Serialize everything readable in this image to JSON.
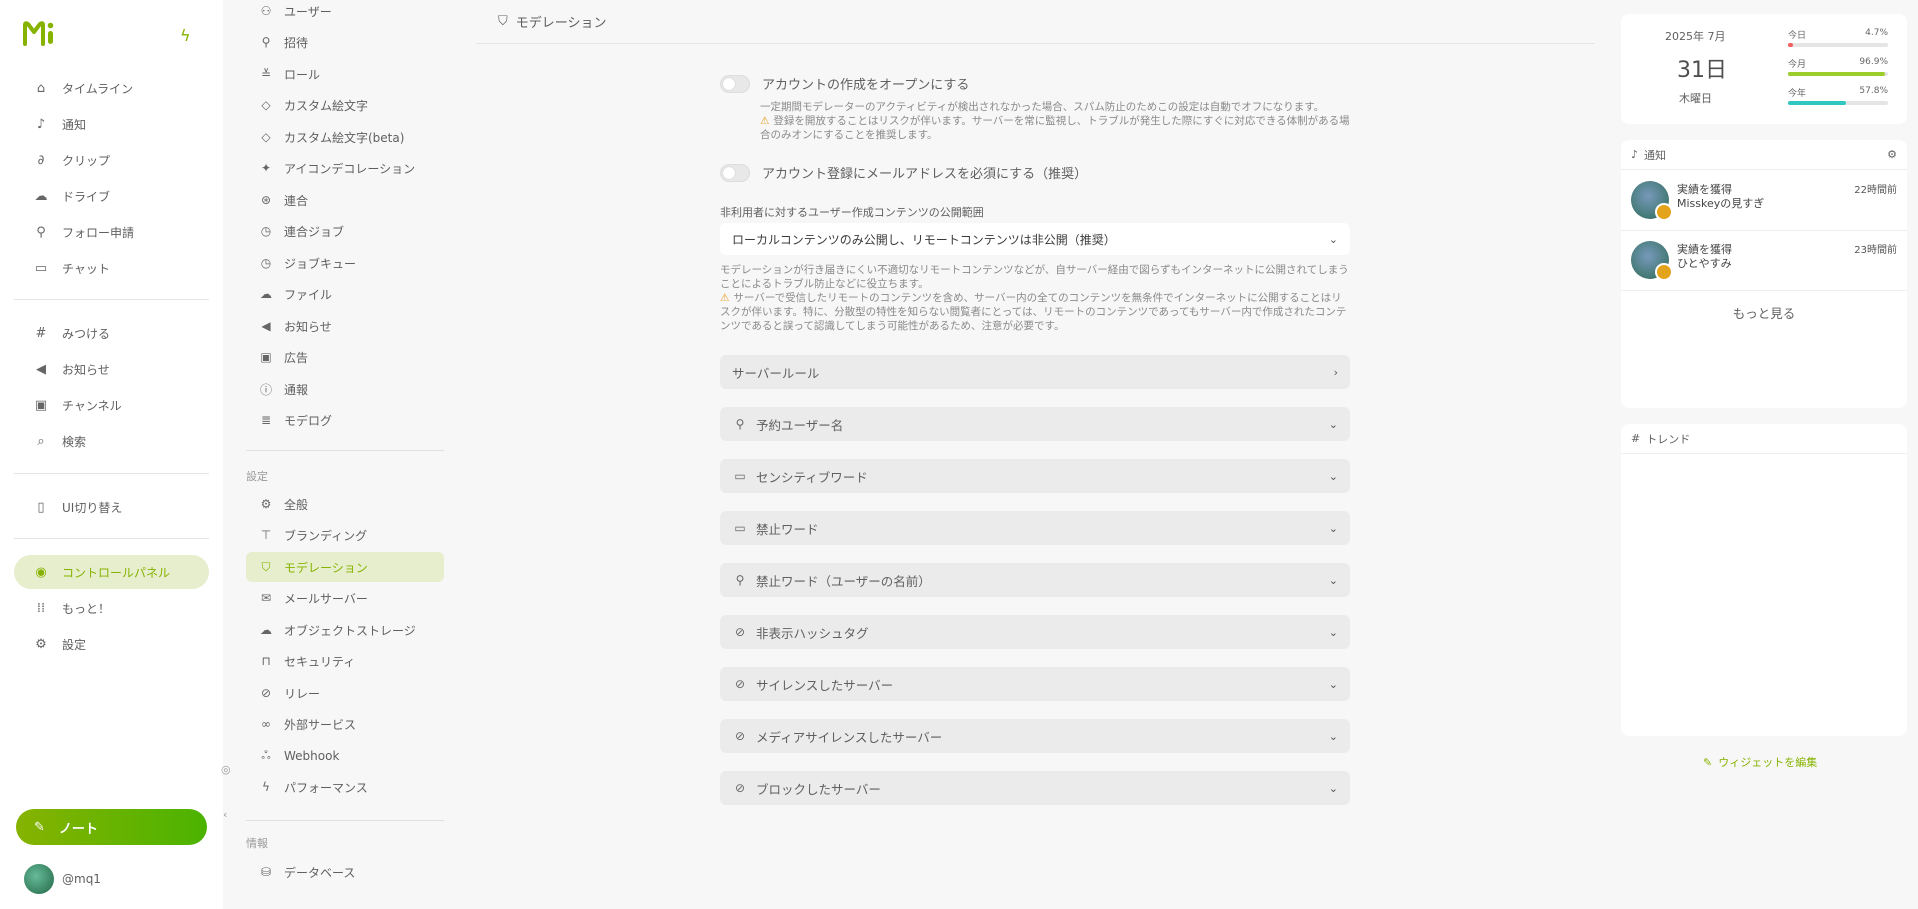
{
  "nav": {
    "items": [
      {
        "label": "タイムライン",
        "icon": "home-icon"
      },
      {
        "label": "通知",
        "icon": "bell-icon"
      },
      {
        "label": "クリップ",
        "icon": "paperclip-icon"
      },
      {
        "label": "ドライブ",
        "icon": "cloud-icon"
      },
      {
        "label": "フォロー申請",
        "icon": "user-plus-icon"
      },
      {
        "label": "チャット",
        "icon": "chat-icon"
      },
      {
        "label": "みつける",
        "icon": "hash-icon"
      },
      {
        "label": "お知らせ",
        "icon": "speaker-icon"
      },
      {
        "label": "チャンネル",
        "icon": "tv-icon"
      },
      {
        "label": "検索",
        "icon": "search-icon"
      },
      {
        "label": "UI切り替え",
        "icon": "devices-icon"
      },
      {
        "label": "コントロールパネル",
        "icon": "gauge-icon"
      },
      {
        "label": "もっと！",
        "icon": "grid-dots-icon"
      },
      {
        "label": "設定",
        "icon": "gear-icon"
      }
    ],
    "note_button": "ノート",
    "account": "@mq1"
  },
  "sidebar": {
    "admin_items": [
      "ユーザー",
      "招待",
      "ロール",
      "カスタム絵文字",
      "カスタム絵文字(beta)",
      "アイコンデコレーション",
      "連合",
      "連合ジョブ",
      "ジョブキュー",
      "ファイル",
      "お知らせ",
      "広告",
      "通報",
      "モデログ"
    ],
    "settings_label": "設定",
    "settings_items": [
      "全般",
      "ブランディング",
      "モデレーション",
      "メールサーバー",
      "オブジェクトストレージ",
      "セキュリティ",
      "リレー",
      "外部サービス",
      "Webhook",
      "パフォーマンス"
    ],
    "info_label": "情報",
    "info_items": [
      "データベース"
    ]
  },
  "main": {
    "title": "モデレーション",
    "toggle_open": "アカウントの作成をオープンにする",
    "toggle_open_caption": "一定期間モデレーターのアクティビティが検出されなかった場合、スパム防止のためこの設定は自動でオフになります。",
    "toggle_open_warn": "登録を開放することはリスクが伴います。サーバーを常に監視し、トラブルが発生した際にすぐに対応できる体制がある場合のみオンにすることを推奨します。",
    "toggle_email": "アカウント登録にメールアドレスを必須にする（推奨）",
    "select_label": "非利用者に対するユーザー作成コンテンツの公開範囲",
    "select_value": "ローカルコンテンツのみ公開し、リモートコンテンツは非公開（推奨）",
    "select_caption": "モデレーションが行き届きにくい不適切なリモートコンテンツなどが、自サーバー経由で図らずもインターネットに公開されてしまうことによるトラブル防止などに役立ちます。",
    "select_warn": "サーバーで受信したリモートのコンテンツを含め、サーバー内の全てのコンテンツを無条件でインターネットに公開することはリスクが伴います。特に、分散型の特性を知らない閲覧者にとっては、リモートのコンテンツであってもサーバー内で作成されたコンテンツであると誤って認識してしまう可能性があるため、注意が必要です。",
    "server_rules": "サーバールール",
    "folders": [
      {
        "label": "予約ユーザー名",
        "icon": "user-lock-icon"
      },
      {
        "label": "センシティブワード",
        "icon": "message-alert-icon"
      },
      {
        "label": "禁止ワード",
        "icon": "message-x-icon"
      },
      {
        "label": "禁止ワード（ユーザーの名前）",
        "icon": "user-x-icon"
      },
      {
        "label": "非表示ハッシュタグ",
        "icon": "eye-off-icon"
      },
      {
        "label": "サイレンスしたサーバー",
        "icon": "eye-off-icon"
      },
      {
        "label": "メディアサイレンスしたサーバー",
        "icon": "eye-off-icon"
      },
      {
        "label": "ブロックしたサーバー",
        "icon": "ban-icon"
      }
    ]
  },
  "widgets": {
    "calendar": {
      "year_month": "2025年 7月",
      "day": "31日",
      "weekday": "木曜日",
      "bars": [
        {
          "label": "今日",
          "pct": "4.7%",
          "value": 0.047,
          "color": "#f26060"
        },
        {
          "label": "今月",
          "pct": "96.9%",
          "value": 0.969,
          "color": "#9bce2b"
        },
        {
          "label": "今年",
          "pct": "57.8%",
          "value": 0.578,
          "color": "#2fc7c0"
        }
      ]
    },
    "notifications": {
      "title": "通知",
      "items": [
        {
          "title": "実績を獲得",
          "body": "Misskeyの見すぎ",
          "time": "22時間前"
        },
        {
          "title": "実績を獲得",
          "body": "ひとやすみ",
          "time": "23時間前"
        }
      ],
      "more": "もっと見る"
    },
    "trends": {
      "title": "トレンド"
    },
    "edit": "ウィジェットを編集"
  },
  "colors": {
    "accent": "#86b300",
    "accent_bg": "#e6eecd",
    "warn": "#e6a11b"
  }
}
